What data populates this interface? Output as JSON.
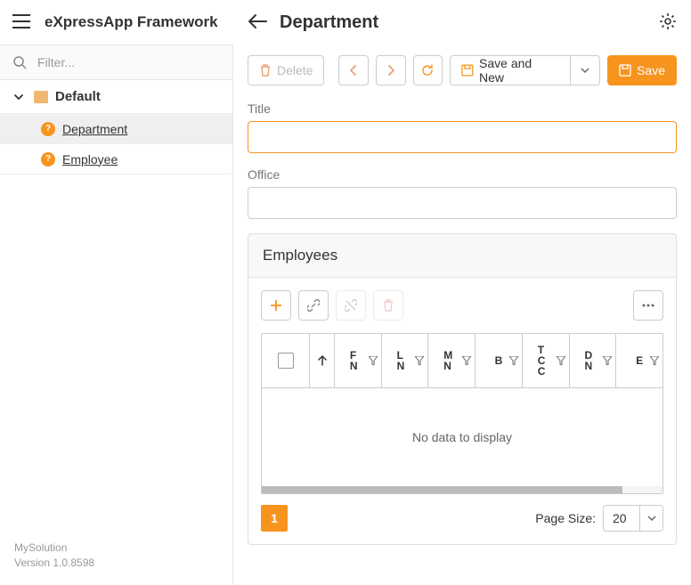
{
  "header": {
    "app_title": "eXpressApp Framework",
    "page_title": "Department"
  },
  "sidebar": {
    "filter_placeholder": "Filter...",
    "group": "Default",
    "items": [
      {
        "label": "Department"
      },
      {
        "label": "Employee"
      }
    ],
    "footer_line1": "MySolution",
    "footer_line2": "Version 1.0.8598"
  },
  "toolbar": {
    "delete": "Delete",
    "save_and_new": "Save and New",
    "save": "Save"
  },
  "fields": {
    "title_label": "Title",
    "title_value": "",
    "office_label": "Office",
    "office_value": ""
  },
  "employees": {
    "heading": "Employees",
    "columns": [
      "F N",
      "L N",
      "M N",
      "B",
      "T C C",
      "D N",
      "E"
    ],
    "empty": "No data to display",
    "page": "1",
    "page_size_label": "Page Size:",
    "page_size": "20"
  }
}
